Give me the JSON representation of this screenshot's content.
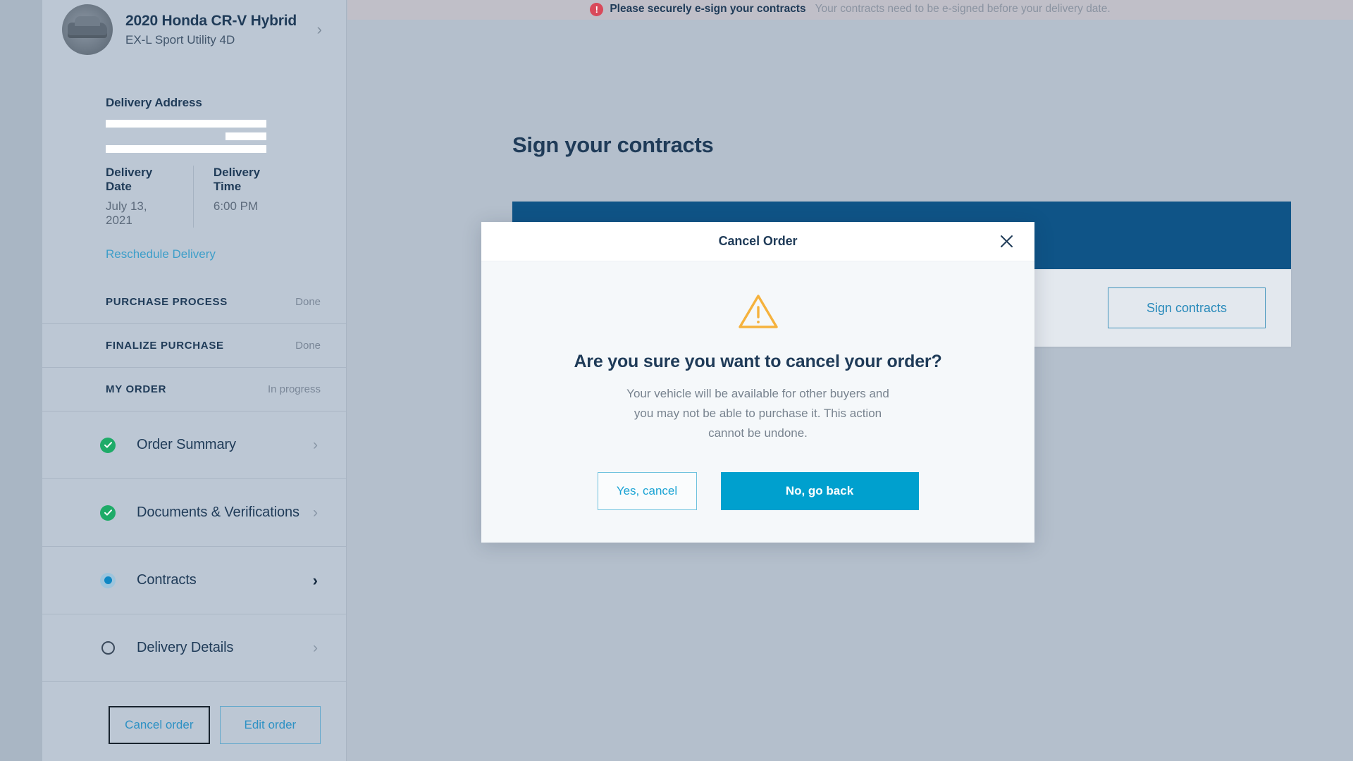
{
  "alert": {
    "icon": "exclamation-circle-icon",
    "strong": "Please securely e-sign your contracts",
    "text": "Your contracts need to be e-signed before your delivery date.",
    "accent": "#d9495a"
  },
  "sidebar": {
    "vehicle": {
      "title": "2020 Honda CR-V Hybrid",
      "subtitle": "EX-L Sport Utility 4D",
      "chevron": "›"
    },
    "address": {
      "label": "Delivery Address"
    },
    "delivery": {
      "date_label": "Delivery Date",
      "date_value": "July 13, 2021",
      "time_label": "Delivery Time",
      "time_value": "6:00 PM"
    },
    "reschedule_label": "Reschedule Delivery",
    "sections": [
      {
        "title": "PURCHASE PROCESS",
        "status": "Done"
      },
      {
        "title": "FINALIZE PURCHASE",
        "status": "Done"
      },
      {
        "title": "MY ORDER",
        "status": "In progress"
      }
    ],
    "nav_items": [
      {
        "label": "Order Summary",
        "state": "check",
        "chevron": "›"
      },
      {
        "label": "Documents & Verifications",
        "state": "check",
        "chevron": "›"
      },
      {
        "label": "Contracts",
        "state": "current",
        "chevron": "›"
      },
      {
        "label": "Delivery Details",
        "state": "empty",
        "chevron": "›"
      }
    ],
    "buttons": {
      "cancel_order": "Cancel order",
      "edit_order": "Edit order"
    }
  },
  "main": {
    "page_title": "Sign your contracts",
    "panel": {
      "header_text": "",
      "sign_button": "Sign contracts"
    }
  },
  "modal": {
    "title": "Cancel Order",
    "close_icon": "close-icon",
    "warning_icon": "warning-triangle-icon",
    "question": "Are you sure you want to cancel your order?",
    "description": "Your vehicle will be available for other buyers and you may not be able to purchase it. This action cannot be undone.",
    "confirm_label": "Yes, cancel",
    "dismiss_label": "No, go back",
    "primary_color": "#00a0ce",
    "warning_color": "#f5b23d"
  }
}
